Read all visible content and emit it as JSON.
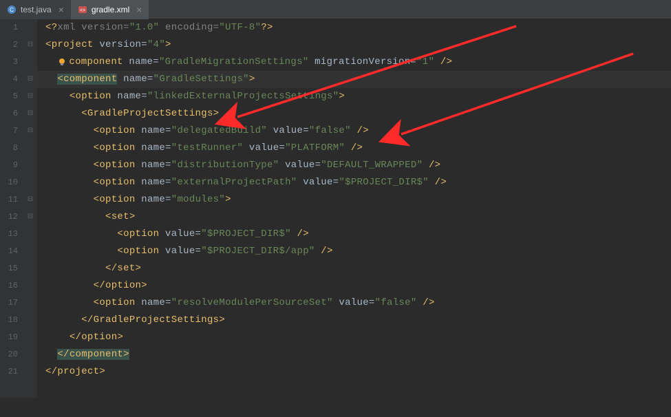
{
  "tabs": [
    {
      "label": "test.java",
      "icon": "java-file-icon",
      "active": false
    },
    {
      "label": "gradle.xml",
      "icon": "xml-file-icon",
      "active": true
    }
  ],
  "lineCount": 21,
  "foldMarkers": [
    "",
    "⊟",
    "",
    "⊟",
    "⊟",
    "⊟",
    "⊟",
    "",
    "",
    "",
    "⊟",
    "⊟",
    "",
    "",
    "",
    "",
    "",
    "",
    "",
    "",
    ""
  ],
  "code": {
    "l1_pre": "<?",
    "l1_pi": "xml version=",
    "l1_v1": "\"1.0\"",
    "l1_enc": " encoding=",
    "l1_v2": "\"UTF-8\"",
    "l1_post": "?>",
    "l2_s": "<",
    "l2_t": "project",
    "l2_a": " version=",
    "l2_v": "\"4\"",
    "l2_e": ">",
    "l3_s": "<",
    "l3_t": "component",
    "l3_a1": " name=",
    "l3_v1": "\"GradleMigrationSettings\"",
    "l3_a2": " migrationVersion=",
    "l3_v2": "\"1\"",
    "l3_e": " />",
    "l4_s": "<",
    "l4_t": "component",
    "l4_a": " name=",
    "l4_v": "\"GradleSettings\"",
    "l4_e": ">",
    "l5_s": "<",
    "l5_t": "option",
    "l5_a": " name=",
    "l5_v": "\"linkedExternalProjectsSettings\"",
    "l5_e": ">",
    "l6_s": "<",
    "l6_t": "GradleProjectSettings",
    "l6_e": ">",
    "l7_s": "<",
    "l7_t": "option",
    "l7_a1": " name=",
    "l7_v1": "\"delegatedBuild\"",
    "l7_a2": " value=",
    "l7_v2": "\"false\"",
    "l7_e": " />",
    "l8_s": "<",
    "l8_t": "option",
    "l8_a1": " name=",
    "l8_v1": "\"testRunner\"",
    "l8_a2": " value=",
    "l8_v2": "\"PLATFORM\"",
    "l8_e": " />",
    "l9_s": "<",
    "l9_t": "option",
    "l9_a1": " name=",
    "l9_v1": "\"distributionType\"",
    "l9_a2": " value=",
    "l9_v2": "\"DEFAULT_WRAPPED\"",
    "l9_e": " />",
    "l10_s": "<",
    "l10_t": "option",
    "l10_a1": " name=",
    "l10_v1": "\"externalProjectPath\"",
    "l10_a2": " value=",
    "l10_v2": "\"$PROJECT_DIR$\"",
    "l10_e": " />",
    "l11_s": "<",
    "l11_t": "option",
    "l11_a": " name=",
    "l11_v": "\"modules\"",
    "l11_e": ">",
    "l12_s": "<",
    "l12_t": "set",
    "l12_e": ">",
    "l13_s": "<",
    "l13_t": "option",
    "l13_a": " value=",
    "l13_v": "\"$PROJECT_DIR$\"",
    "l13_e": " />",
    "l14_s": "<",
    "l14_t": "option",
    "l14_a": " value=",
    "l14_v": "\"$PROJECT_DIR$/app\"",
    "l14_e": " />",
    "l15_s": "</",
    "l15_t": "set",
    "l15_e": ">",
    "l16_s": "</",
    "l16_t": "option",
    "l16_e": ">",
    "l17_s": "<",
    "l17_t": "option",
    "l17_a1": " name=",
    "l17_v1": "\"resolveModulePerSourceSet\"",
    "l17_a2": " value=",
    "l17_v2": "\"false\"",
    "l17_e": " />",
    "l18_s": "</",
    "l18_t": "GradleProjectSettings",
    "l18_e": ">",
    "l19_s": "</",
    "l19_t": "option",
    "l19_e": ">",
    "l20_s": "</",
    "l20_t": "component",
    "l20_e": ">",
    "l21_s": "</",
    "l21_t": "project",
    "l21_e": ">"
  }
}
